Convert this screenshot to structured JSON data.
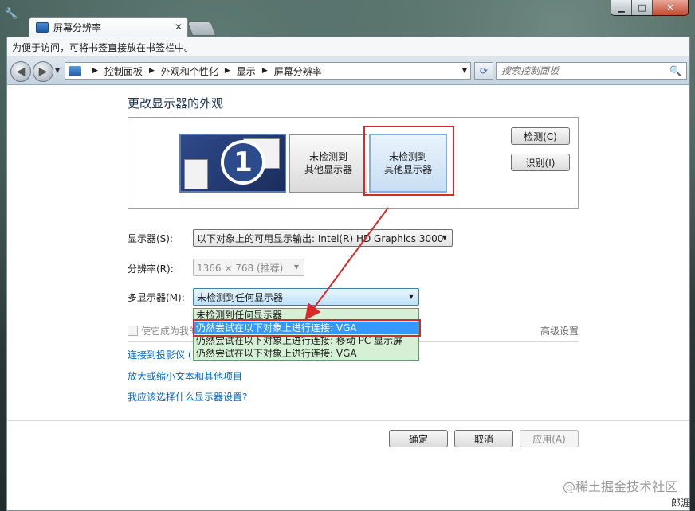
{
  "tab": {
    "title": "屏幕分辨率"
  },
  "bookmark_bar": {
    "text": "为便于访问，可将书签直接放在书签栏中。"
  },
  "address": {
    "crumbs": [
      "控制面板",
      "外观和个性化",
      "显示",
      "屏幕分辨率"
    ]
  },
  "search": {
    "placeholder": "搜索控制面板"
  },
  "page": {
    "title": "更改显示器的外观"
  },
  "monitors": {
    "primary_number": "1",
    "undetected_line1": "未检测到",
    "undetected_line2": "其他显示器"
  },
  "side_buttons": {
    "detect": "检测(C)",
    "identify": "识别(I)"
  },
  "display": {
    "label": "显示器(S):",
    "value": "以下对象上的可用显示输出: Intel(R) HD Graphics 3000"
  },
  "resolution": {
    "label": "分辨率(R):",
    "value": "1366 × 768 (推荐)"
  },
  "multi_display": {
    "label": "多显示器(M):",
    "value": "未检测到任何显示器",
    "options": [
      "未检测到任何显示器",
      "仍然尝试在以下对象上进行连接: VGA",
      "仍然尝试在以下对象上进行连接: 移动 PC 显示屏",
      "仍然尝试在以下对象上进行连接: VGA"
    ],
    "selected_index": 1
  },
  "checkbox": {
    "label": "使它成为我的"
  },
  "advanced": "高级设置",
  "links": {
    "projector": "连接到投影仪 (",
    "text_size": "放大或缩小文本和其他项目",
    "which_settings": "我应该选择什么显示器设置?"
  },
  "buttons": {
    "ok": "确定",
    "cancel": "取消",
    "apply": "应用(A)"
  },
  "watermark": "@稀土掘金技术社区",
  "corner_text": "郎涯",
  "colors": {
    "highlight": "#d82a2a",
    "selection": "#3399ff",
    "link": "#0066cc"
  }
}
